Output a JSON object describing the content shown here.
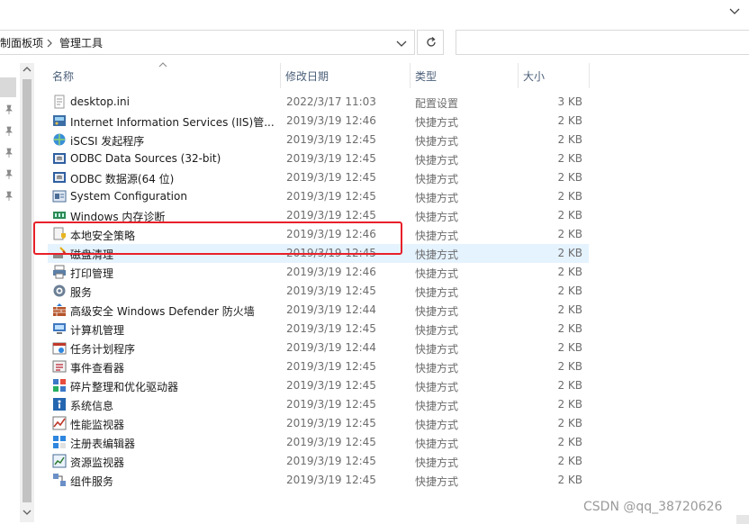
{
  "address": {
    "breadcrumbs": [
      "制面板项",
      "管理工具"
    ]
  },
  "columns": [
    {
      "id": "name",
      "label": "名称"
    },
    {
      "id": "date",
      "label": "修改日期"
    },
    {
      "id": "type",
      "label": "类型"
    },
    {
      "id": "size",
      "label": "大小"
    }
  ],
  "files": [
    {
      "name": "desktop.ini",
      "date": "2022/3/17 11:03",
      "type": "配置设置",
      "size": "3 KB",
      "icon": "ini-file-icon"
    },
    {
      "name": "Internet Information Services (IIS)管...",
      "date": "2019/3/19 12:46",
      "type": "快捷方式",
      "size": "2 KB",
      "icon": "iis-manager-icon"
    },
    {
      "name": "iSCSI 发起程序",
      "date": "2019/3/19 12:45",
      "type": "快捷方式",
      "size": "2 KB",
      "icon": "iscsi-icon"
    },
    {
      "name": "ODBC Data Sources (32-bit)",
      "date": "2019/3/19 12:45",
      "type": "快捷方式",
      "size": "2 KB",
      "icon": "odbc-icon"
    },
    {
      "name": "ODBC 数据源(64 位)",
      "date": "2019/3/19 12:45",
      "type": "快捷方式",
      "size": "2 KB",
      "icon": "odbc-icon"
    },
    {
      "name": "System Configuration",
      "date": "2019/3/19 12:45",
      "type": "快捷方式",
      "size": "2 KB",
      "icon": "system-config-icon"
    },
    {
      "name": "Windows 内存诊断",
      "date": "2019/3/19 12:45",
      "type": "快捷方式",
      "size": "2 KB",
      "icon": "memory-diagnostic-icon"
    },
    {
      "name": "本地安全策略",
      "date": "2019/3/19 12:46",
      "type": "快捷方式",
      "size": "2 KB",
      "icon": "security-policy-icon"
    },
    {
      "name": "磁盘清理",
      "date": "2019/3/19 12:45",
      "type": "快捷方式",
      "size": "2 KB",
      "icon": "disk-cleanup-icon"
    },
    {
      "name": "打印管理",
      "date": "2019/3/19 12:46",
      "type": "快捷方式",
      "size": "2 KB",
      "icon": "print-management-icon"
    },
    {
      "name": "服务",
      "date": "2019/3/19 12:45",
      "type": "快捷方式",
      "size": "2 KB",
      "icon": "services-icon"
    },
    {
      "name": "高级安全 Windows Defender 防火墙",
      "date": "2019/3/19 12:44",
      "type": "快捷方式",
      "size": "2 KB",
      "icon": "firewall-icon"
    },
    {
      "name": "计算机管理",
      "date": "2019/3/19 12:45",
      "type": "快捷方式",
      "size": "2 KB",
      "icon": "computer-management-icon"
    },
    {
      "name": "任务计划程序",
      "date": "2019/3/19 12:44",
      "type": "快捷方式",
      "size": "2 KB",
      "icon": "task-scheduler-icon"
    },
    {
      "name": "事件查看器",
      "date": "2019/3/19 12:45",
      "type": "快捷方式",
      "size": "2 KB",
      "icon": "event-viewer-icon"
    },
    {
      "name": "碎片整理和优化驱动器",
      "date": "2019/3/19 12:45",
      "type": "快捷方式",
      "size": "2 KB",
      "icon": "defrag-icon"
    },
    {
      "name": "系统信息",
      "date": "2019/3/19 12:45",
      "type": "快捷方式",
      "size": "2 KB",
      "icon": "system-info-icon"
    },
    {
      "name": "性能监视器",
      "date": "2019/3/19 12:45",
      "type": "快捷方式",
      "size": "2 KB",
      "icon": "performance-monitor-icon"
    },
    {
      "name": "注册表编辑器",
      "date": "2019/3/19 12:45",
      "type": "快捷方式",
      "size": "2 KB",
      "icon": "registry-editor-icon"
    },
    {
      "name": "资源监视器",
      "date": "2019/3/19 12:45",
      "type": "快捷方式",
      "size": "2 KB",
      "icon": "resource-monitor-icon"
    },
    {
      "name": "组件服务",
      "date": "2019/3/19 12:45",
      "type": "快捷方式",
      "size": "2 KB",
      "icon": "component-services-icon"
    }
  ],
  "hovered_row": 8,
  "highlighted_row": 7,
  "colors": {
    "highlight_border": "#e8202a",
    "hover_background": "#e5f3ff",
    "header_text": "#4c607a"
  },
  "watermark": "CSDN @qq_38720626"
}
